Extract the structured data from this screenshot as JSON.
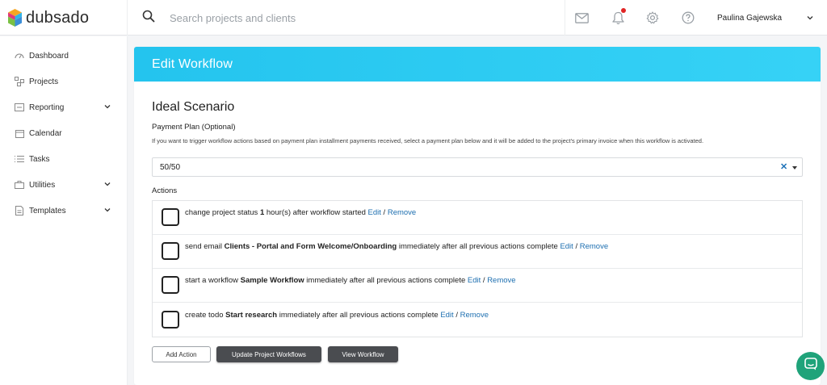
{
  "app": {
    "logo_text": "dubsado"
  },
  "topbar": {
    "search_placeholder": "Search projects and clients",
    "user_name": "Paulina Gajewska"
  },
  "sidebar": {
    "items": [
      {
        "label": "Dashboard",
        "icon": "dashboard-icon"
      },
      {
        "label": "Projects",
        "icon": "projects-icon"
      },
      {
        "label": "Reporting",
        "icon": "reporting-icon",
        "expandable": true
      },
      {
        "label": "Calendar",
        "icon": "calendar-icon"
      },
      {
        "label": "Tasks",
        "icon": "tasks-icon"
      },
      {
        "label": "Utilities",
        "icon": "utilities-icon",
        "expandable": true
      },
      {
        "label": "Templates",
        "icon": "templates-icon",
        "expandable": true
      }
    ]
  },
  "card": {
    "title": "Edit Workflow",
    "workflow_name": "Ideal Scenario",
    "payment_plan_label": "Payment Plan (Optional)",
    "payment_plan_help": "If you want to trigger workflow actions based on payment plan installment payments received, select a payment plan below and it will be added to the project's primary invoice when this workflow is activated.",
    "payment_plan_value": "50/50",
    "actions_label": "Actions",
    "actions": [
      {
        "pre": "change project status ",
        "bold": "1",
        "post": " hour(s) after workflow started "
      },
      {
        "pre": "send email ",
        "bold": "Clients - Portal and Form Welcome/Onboarding",
        "post": " immediately after all previous actions complete "
      },
      {
        "pre": "start a workflow ",
        "bold": "Sample Workflow",
        "post": " immediately after all previous actions complete "
      },
      {
        "pre": "create todo ",
        "bold": "Start research",
        "post": " immediately after all previous actions complete "
      }
    ],
    "edit_label": "Edit",
    "slash": " / ",
    "remove_label": "Remove",
    "buttons": {
      "add_action": "Add Action",
      "update_project_workflows": "Update Project Workflows",
      "view_workflow": "View Workflow"
    }
  },
  "colors": {
    "header_accent": "#2dcaf2",
    "link": "#1d6fb0",
    "dark_button": "#4a4c50",
    "chat_button": "#1fa37a",
    "notification_dot": "#e02424"
  }
}
